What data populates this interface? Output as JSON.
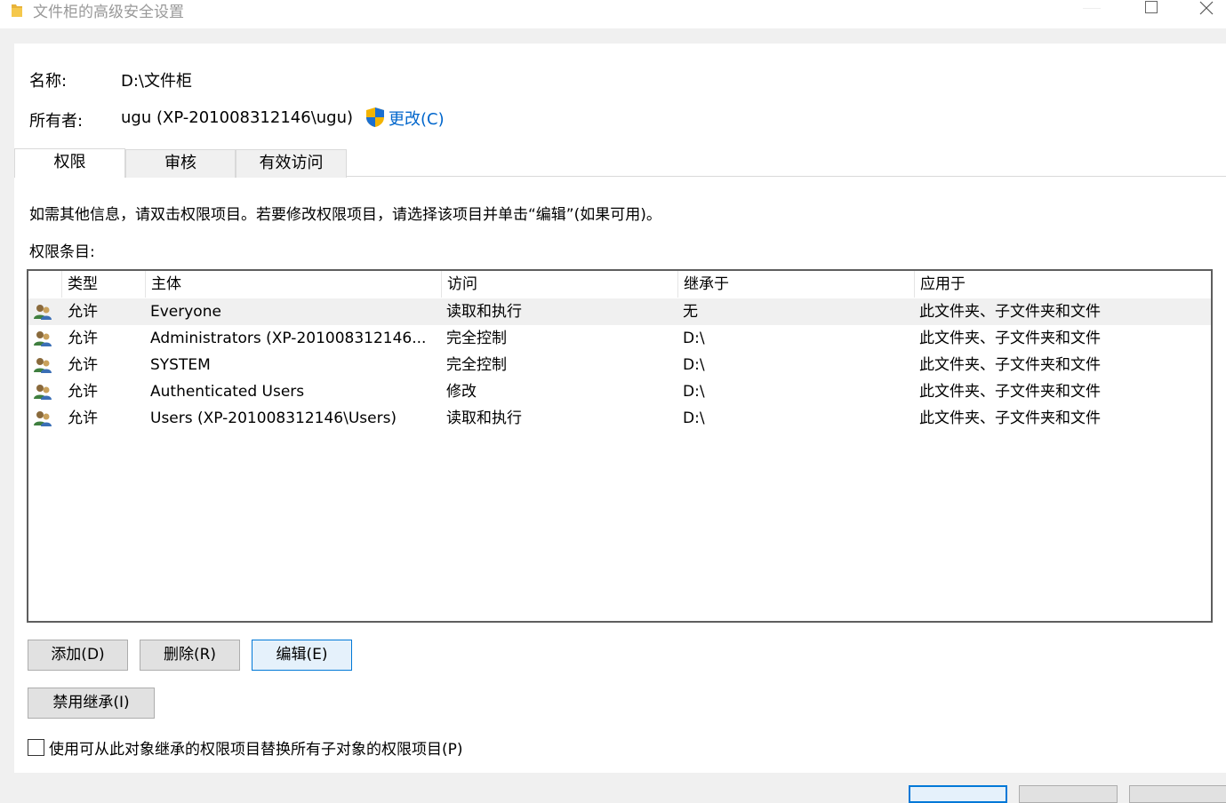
{
  "window": {
    "title": "文件柜的高级安全设置",
    "folder_icon": "folder-icon",
    "controls": [
      "minimize-icon",
      "maximize-icon",
      "close-icon"
    ]
  },
  "info": {
    "name_label": "名称:",
    "name_value": "D:\\文件柜",
    "owner_label": "所有者:",
    "owner_value": "ugu (XP-201008312146\\ugu)",
    "change_link": "更改(C)",
    "change_icon": "uac-shield-icon"
  },
  "tabs": [
    {
      "label": "权限",
      "active": true
    },
    {
      "label": "审核",
      "active": false
    },
    {
      "label": "有效访问",
      "active": false
    }
  ],
  "description": "如需其他信息，请双击权限项目。若要修改权限项目，请选择该项目并单击“编辑”(如果可用)。",
  "entries_label": "权限条目:",
  "table": {
    "columns": [
      "类型",
      "主体",
      "访问",
      "继承于",
      "应用于"
    ],
    "row_icon": "users-group-icon",
    "rows": [
      {
        "type": "允许",
        "principal": "Everyone",
        "access": "读取和执行",
        "inherited_from": "无",
        "applies_to": "此文件夹、子文件夹和文件"
      },
      {
        "type": "允许",
        "principal": "Administrators (XP-201008312146...",
        "access": "完全控制",
        "inherited_from": "D:\\",
        "applies_to": "此文件夹、子文件夹和文件"
      },
      {
        "type": "允许",
        "principal": "SYSTEM",
        "access": "完全控制",
        "inherited_from": "D:\\",
        "applies_to": "此文件夹、子文件夹和文件"
      },
      {
        "type": "允许",
        "principal": "Authenticated Users",
        "access": "修改",
        "inherited_from": "D:\\",
        "applies_to": "此文件夹、子文件夹和文件"
      },
      {
        "type": "允许",
        "principal": "Users (XP-201008312146\\Users)",
        "access": "读取和执行",
        "inherited_from": "D:\\",
        "applies_to": "此文件夹、子文件夹和文件"
      }
    ]
  },
  "buttons": {
    "add": "添加(D)",
    "remove": "删除(R)",
    "edit": "编辑(E)",
    "disable_inheritance": "禁用继承(I)"
  },
  "replace_checkbox": {
    "label": "使用可从此对象继承的权限项目替换所有子对象的权限项目(P)",
    "checked": false
  },
  "colors": {
    "link": "#0066cc",
    "focus_border": "#0078d7",
    "selected_row": "#f0f0f0"
  }
}
